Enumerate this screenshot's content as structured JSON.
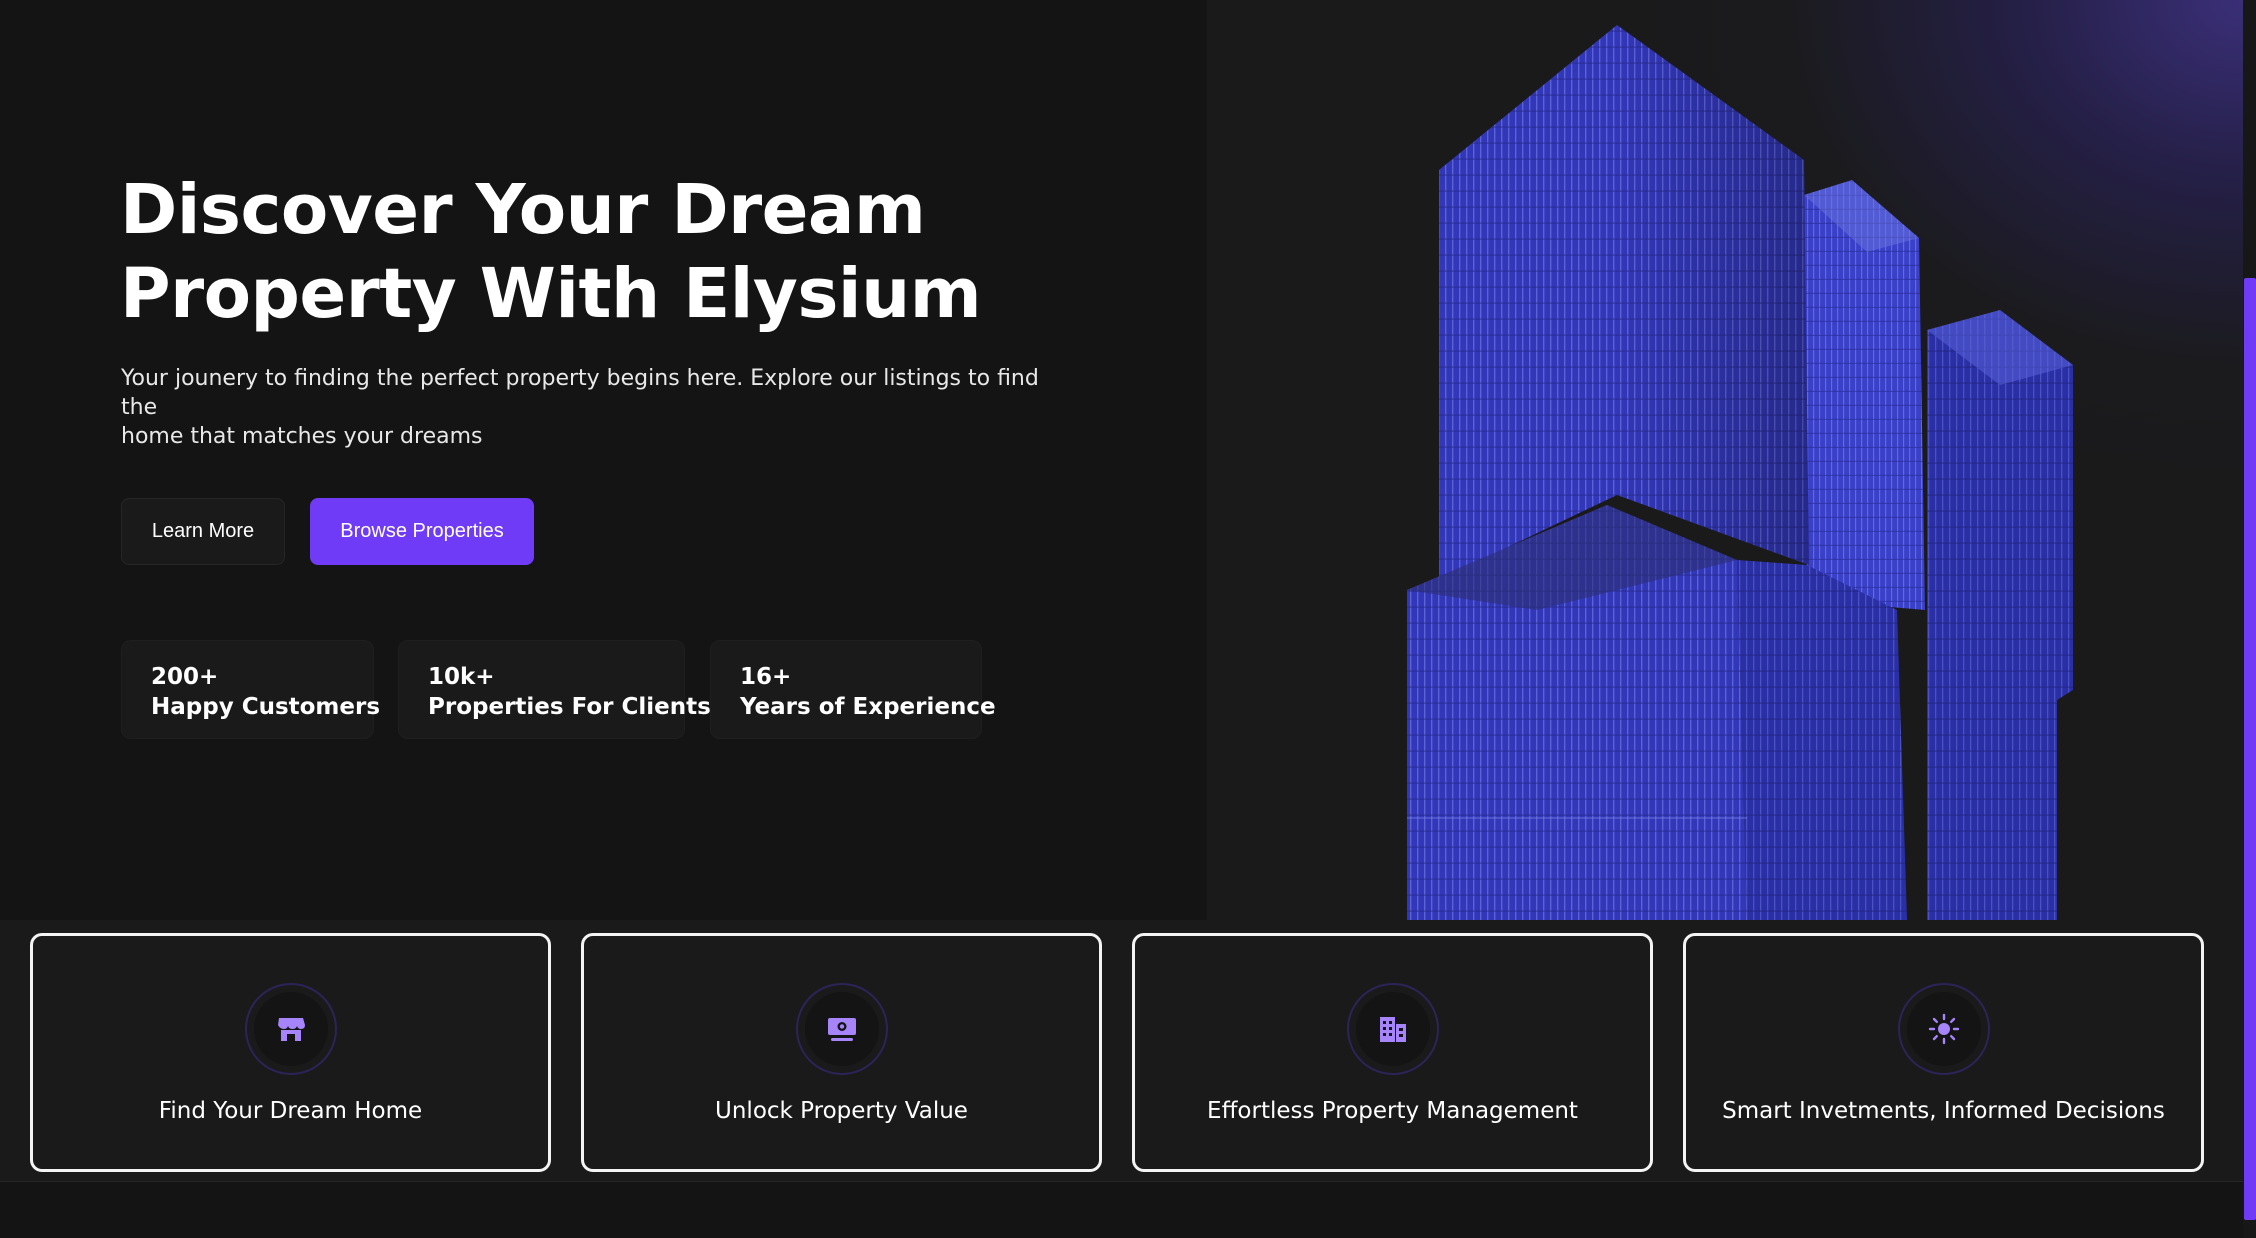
{
  "hero": {
    "title_line1": "Discover Your Dream",
    "title_line2": "Property With Elysium",
    "subtitle_line1": "Your jounery to finding the perfect property begins here. Explore our listings to find the",
    "subtitle_line2": "home that matches your dreams",
    "learn_more_label": "Learn More",
    "browse_label": "Browse Properties",
    "accent_color": "#703bf7"
  },
  "stats": [
    {
      "number": "200+",
      "label": "Happy Customers"
    },
    {
      "number": "10k+",
      "label": "Properties For Clients"
    },
    {
      "number": "16+",
      "label": "Years of Experience"
    }
  ],
  "features": [
    {
      "label": "Find Your Dream Home",
      "icon": "storefront-icon"
    },
    {
      "label": "Unlock Property Value",
      "icon": "money-icon"
    },
    {
      "label": "Effortless Property Management",
      "icon": "buildings-icon"
    },
    {
      "label": "Smart Invetments, Informed Decisions",
      "icon": "sun-icon"
    }
  ]
}
